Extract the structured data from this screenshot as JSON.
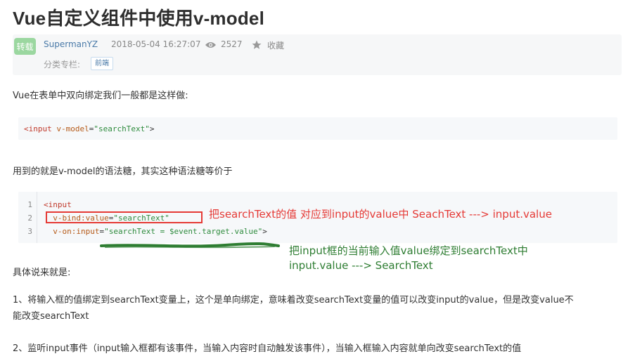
{
  "article": {
    "title": "Vue自定义组件中使用v-model",
    "badge": "转载",
    "author": "SupermanYZ",
    "date": "2018-05-04 16:27:07",
    "views": "2527",
    "collect_label": "收藏",
    "category_label": "分类专栏:",
    "category_tag": "前端"
  },
  "content": {
    "p1": "Vue在表单中双向绑定我们一般都是这样做:",
    "code1": {
      "tag_open": "<input",
      "attr": "v-model",
      "eq": "=",
      "value": "\"searchText\"",
      "close": ">"
    },
    "p2": "用到的就是v-model的语法糖，其实这种语法糖等价于",
    "code2": {
      "line_numbers": [
        "1",
        "2",
        "3"
      ],
      "l1_tag": "<input",
      "l2_attr": "v-bind:value",
      "l2_eq": "=",
      "l2_value": "\"searchText\"",
      "l3_attr": "v-on:input",
      "l3_eq": "=",
      "l3_value": "\"searchText = $event.target.value\"",
      "l3_close": ">"
    },
    "annotation_red": "把searchText的值 对应到input的value中    SeachText ---> input.value",
    "annotation_green_1": "把input框的当前输入值value绑定到searchText中",
    "annotation_green_2": "input.value ---> SearchText",
    "p3": "具体说来就是:",
    "p4_line1": "1、将输入框的值绑定到searchText变量上，这个是单向绑定，意味着改变searchText变量的值可以改变input的value，但是改变value不",
    "p4_line2": "能改变searchText",
    "p5": "2、监听input事件（input输入框都有该事件，当输入内容时自动触发该事件），当输入框输入内容就单向改变searchText的值"
  },
  "colors": {
    "annotation_red": "#e53935",
    "annotation_green": "#2e7d32",
    "badge": "#9bd7a0",
    "link": "#4a7aa8"
  },
  "icons": [
    "eye-icon",
    "star-icon"
  ]
}
